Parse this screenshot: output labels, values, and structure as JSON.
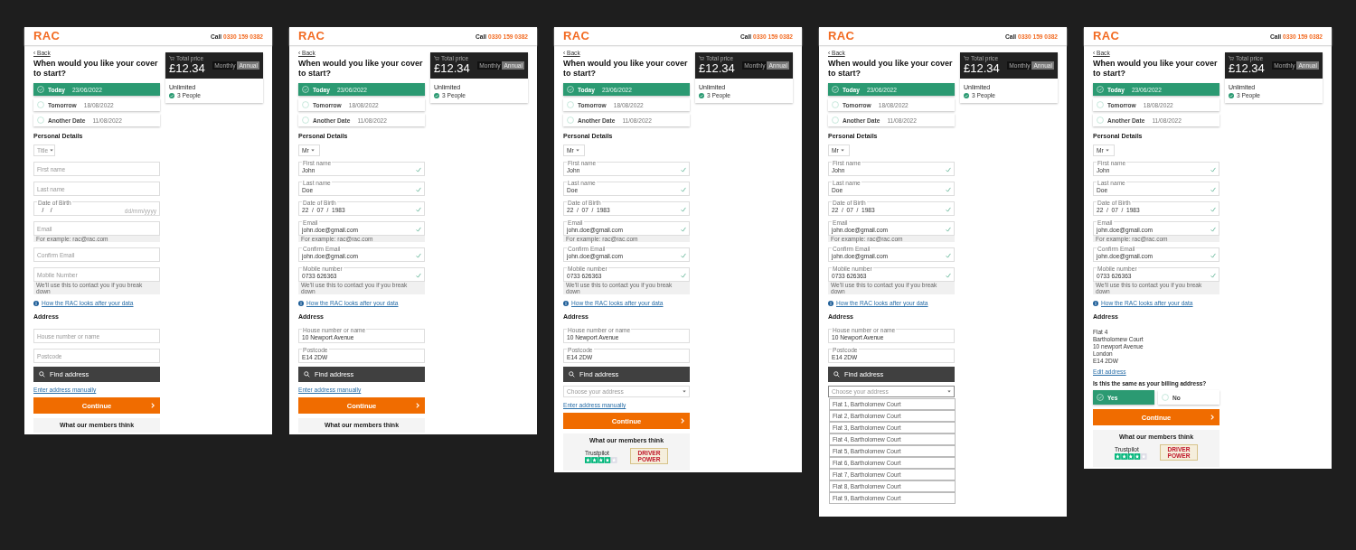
{
  "screens": [
    {
      "header": {
        "logo": "RAC",
        "call_label": "Call",
        "phone": "0330 159 0382"
      },
      "back": "‹ Back",
      "heading": "When would you like your cover to start?",
      "start_options": [
        {
          "label": "Today",
          "date": "23/06/2022",
          "selected": true
        },
        {
          "label": "Tomorrow",
          "date": "18/08/2022",
          "selected": false
        },
        {
          "label": "Another Date",
          "date": "11/08/2022",
          "selected": false
        }
      ],
      "personal_heading": "Personal Details",
      "title_select": {
        "placeholder": "Title"
      },
      "fields": [
        {
          "placeholder": "First name",
          "valid": false
        },
        {
          "placeholder": "Last name",
          "valid": false
        },
        {
          "label": "Date of Birth",
          "value": "   /    /",
          "hint": "dd/mm/yyyy",
          "valid": false
        },
        {
          "placeholder": "Email",
          "helper": "For example: rac@rac.com",
          "valid": false
        },
        {
          "placeholder": "Confirm Email",
          "valid": false
        },
        {
          "placeholder": "Mobile Number",
          "helper": "We'll use this to contact you if you break down",
          "valid": false
        }
      ],
      "privacy_link": "How the RAC looks after your data",
      "address": {
        "kind": "search",
        "heading": "Address",
        "fields": [
          {
            "placeholder": "House number or name",
            "valid": false
          },
          {
            "placeholder": "Postcode",
            "valid": false
          }
        ],
        "find_button": "Find address",
        "manual_link": "Enter address manually"
      },
      "continue": "Continue",
      "reviews": {
        "heading": "What our members think"
      },
      "summary": {
        "total_label": "Total price",
        "price": "£12.34",
        "periods": [
          {
            "label": "Monthly",
            "selected": false
          },
          {
            "label": "Annual",
            "selected": true
          }
        ],
        "plan": "Unlimited",
        "feature": "3 People"
      }
    },
    {
      "header": {
        "logo": "RAC",
        "call_label": "Call",
        "phone": "0330 159 0382"
      },
      "back": "‹ Back",
      "heading": "When would you like your cover to start?",
      "start_options": [
        {
          "label": "Today",
          "date": "23/06/2022",
          "selected": true
        },
        {
          "label": "Tomorrow",
          "date": "18/08/2022",
          "selected": false
        },
        {
          "label": "Another Date",
          "date": "11/08/2022",
          "selected": false
        }
      ],
      "personal_heading": "Personal Details",
      "title_select": {
        "value": "Mr"
      },
      "fields": [
        {
          "label": "First name",
          "value": "John",
          "valid": true
        },
        {
          "label": "Last name",
          "value": "Doe",
          "valid": true
        },
        {
          "label": "Date of Birth",
          "value": "22  /  07  /  1983",
          "valid": true
        },
        {
          "label": "Email",
          "value": "john.doe@gmail.com",
          "helper": "For example: rac@rac.com",
          "valid": true
        },
        {
          "label": "Confirm Email",
          "value": "john.doe@gmail.com",
          "valid": true
        },
        {
          "label": "Mobile number",
          "value": "0733 626363",
          "helper": "We'll use this to contact you if you break down",
          "valid": true
        }
      ],
      "privacy_link": "How the RAC looks after your data",
      "address": {
        "kind": "search",
        "heading": "Address",
        "fields": [
          {
            "label": "House number or name",
            "value": "10 Newport Avenue",
            "valid": false
          },
          {
            "label": "Postcode",
            "value": "E14 2DW",
            "valid": false
          }
        ],
        "find_button": "Find address",
        "manual_link": "Enter address manually"
      },
      "continue": "Continue",
      "reviews": {
        "heading": "What our members think"
      },
      "summary": {
        "total_label": "Total price",
        "price": "£12.34",
        "periods": [
          {
            "label": "Monthly",
            "selected": false
          },
          {
            "label": "Annual",
            "selected": true
          }
        ],
        "plan": "Unlimited",
        "feature": "3 People"
      }
    },
    {
      "header": {
        "logo": "RAC",
        "call_label": "Call",
        "phone": "0330 159 0382"
      },
      "back": "‹ Back",
      "heading": "When would you like your cover to start?",
      "start_options": [
        {
          "label": "Today",
          "date": "23/06/2022",
          "selected": true
        },
        {
          "label": "Tomorrow",
          "date": "18/08/2022",
          "selected": false
        },
        {
          "label": "Another Date",
          "date": "11/08/2022",
          "selected": false
        }
      ],
      "personal_heading": "Personal Details",
      "title_select": {
        "value": "Mr"
      },
      "fields": [
        {
          "label": "First name",
          "value": "John",
          "valid": true
        },
        {
          "label": "Last name",
          "value": "Doe",
          "valid": true
        },
        {
          "label": "Date of Birth",
          "value": "22  /  07  /  1983",
          "valid": true
        },
        {
          "label": "Email",
          "value": "john.doe@gmail.com",
          "helper": "For example: rac@rac.com",
          "valid": true
        },
        {
          "label": "Confirm Email",
          "value": "john.doe@gmail.com",
          "valid": true
        },
        {
          "label": "Mobile number",
          "value": "0733 626363",
          "helper": "We'll use this to contact you if you break down",
          "valid": true
        }
      ],
      "privacy_link": "How the RAC looks after your data",
      "address": {
        "kind": "search",
        "heading": "Address",
        "fields": [
          {
            "label": "House number or name",
            "value": "10 Newport Avenue",
            "valid": false
          },
          {
            "label": "Postcode",
            "value": "E14 2DW",
            "valid": false
          }
        ],
        "find_button": "Find address",
        "chooser": {
          "placeholder": "Choose your address",
          "expanded": false
        },
        "manual_link": "Enter address manually"
      },
      "continue": "Continue",
      "reviews": {
        "heading": "What our members think",
        "trustpilot": "Trustpilot",
        "award_lines": [
          "DRIVER",
          "POWER"
        ]
      },
      "summary": {
        "total_label": "Total price",
        "price": "£12.34",
        "periods": [
          {
            "label": "Monthly",
            "selected": false
          },
          {
            "label": "Annual",
            "selected": true
          }
        ],
        "plan": "Unlimited",
        "feature": "3 People"
      }
    },
    {
      "header": {
        "logo": "RAC",
        "call_label": "Call",
        "phone": "0330 159 0382"
      },
      "back": "‹ Back",
      "heading": "When would you like your cover to start?",
      "start_options": [
        {
          "label": "Today",
          "date": "23/06/2022",
          "selected": true
        },
        {
          "label": "Tomorrow",
          "date": "18/08/2022",
          "selected": false
        },
        {
          "label": "Another Date",
          "date": "11/08/2022",
          "selected": false
        }
      ],
      "personal_heading": "Personal Details",
      "title_select": {
        "value": "Mr"
      },
      "fields": [
        {
          "label": "First name",
          "value": "John",
          "valid": true
        },
        {
          "label": "Last name",
          "value": "Doe",
          "valid": true
        },
        {
          "label": "Date of Birth",
          "value": "22  /  07  /  1983",
          "valid": true
        },
        {
          "label": "Email",
          "value": "john.doe@gmail.com",
          "helper": "For example: rac@rac.com",
          "valid": true
        },
        {
          "label": "Confirm Email",
          "value": "john.doe@gmail.com",
          "valid": true
        },
        {
          "label": "Mobile number",
          "value": "0733 626363",
          "helper": "We'll use this to contact you if you break down",
          "valid": true
        }
      ],
      "privacy_link": "How the RAC looks after your data",
      "address": {
        "kind": "search",
        "heading": "Address",
        "fields": [
          {
            "label": "House number or name",
            "value": "10 Newport Avenue",
            "valid": false
          },
          {
            "label": "Postcode",
            "value": "E14 2DW",
            "valid": false
          }
        ],
        "find_button": "Find address",
        "chooser": {
          "placeholder": "Choose your address",
          "expanded": true,
          "options": [
            "Flat 1, Bartholomew Court",
            "Flat 2, Bartholomew Court",
            "Flat 3, Bartholomew Court",
            "Flat 4, Bartholomew Court",
            "Flat 5, Bartholomew Court",
            "Flat 6, Bartholomew Court",
            "Flat 7, Bartholomew Court",
            "Flat 8, Bartholomew Court",
            "Flat 9, Bartholomew Court"
          ]
        }
      },
      "summary": {
        "total_label": "Total price",
        "price": "£12.34",
        "periods": [
          {
            "label": "Monthly",
            "selected": false
          },
          {
            "label": "Annual",
            "selected": true
          }
        ],
        "plan": "Unlimited",
        "feature": "3 People"
      }
    },
    {
      "header": {
        "logo": "RAC",
        "call_label": "Call",
        "phone": "0330 159 0382"
      },
      "back": "‹ Back",
      "heading": "When would you like your cover to start?",
      "start_options": [
        {
          "label": "Today",
          "date": "23/06/2022",
          "selected": true
        },
        {
          "label": "Tomorrow",
          "date": "18/08/2022",
          "selected": false
        },
        {
          "label": "Another Date",
          "date": "11/08/2022",
          "selected": false
        }
      ],
      "personal_heading": "Personal Details",
      "title_select": {
        "value": "Mr"
      },
      "fields": [
        {
          "label": "First name",
          "value": "John",
          "valid": true
        },
        {
          "label": "Last name",
          "value": "Doe",
          "valid": true
        },
        {
          "label": "Date of Birth",
          "value": "22  /  07  /  1983",
          "valid": true
        },
        {
          "label": "Email",
          "value": "john.doe@gmail.com",
          "helper": "For example: rac@rac.com",
          "valid": true
        },
        {
          "label": "Confirm Email",
          "value": "john.doe@gmail.com",
          "valid": true
        },
        {
          "label": "Mobile number",
          "value": "0733 626363",
          "helper": "We'll use this to contact you if you break down",
          "valid": true
        }
      ],
      "privacy_link": "How the RAC looks after your data",
      "address": {
        "kind": "confirmed",
        "heading": "Address",
        "lines": [
          "Flat 4",
          "Bartholomew Court",
          "10 newport Avenue",
          "London",
          "E14 2DW"
        ],
        "edit_link": "Edit address",
        "billing_question": "Is this the same as your billing address?",
        "billing_options": [
          {
            "label": "Yes",
            "selected": true
          },
          {
            "label": "No",
            "selected": false
          }
        ]
      },
      "continue": "Continue",
      "reviews": {
        "heading": "What our members think",
        "trustpilot": "Trustpilot",
        "award_lines": [
          "DRIVER",
          "POWER"
        ]
      },
      "summary": {
        "total_label": "Total price",
        "price": "£12.34",
        "periods": [
          {
            "label": "Monthly",
            "selected": false
          },
          {
            "label": "Annual",
            "selected": true
          }
        ],
        "plan": "Unlimited",
        "feature": "3 People"
      }
    }
  ]
}
